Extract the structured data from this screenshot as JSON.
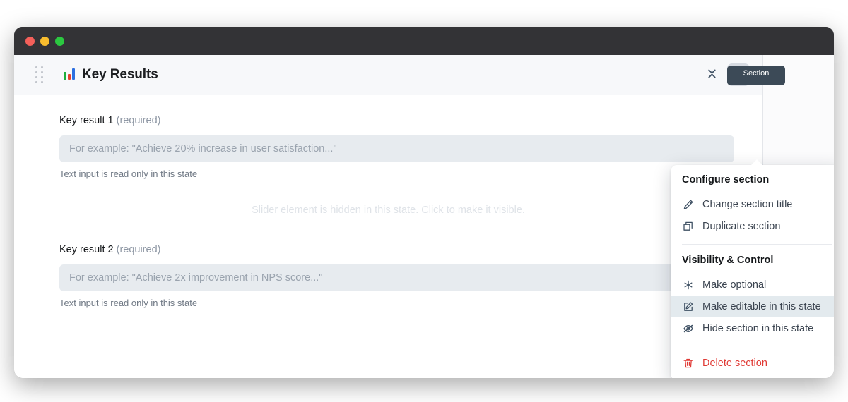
{
  "window": {
    "traffic_lights": [
      "close",
      "minimize",
      "maximize"
    ],
    "tooltip_text": "Section"
  },
  "section": {
    "emoji_icon": "bar-chart-emoji",
    "title": "Key Results",
    "drag_handle_icon": "drag-handle-icon",
    "collapse_icon": "collapse-chevrons-icon",
    "more_icon": "more-horizontal-icon"
  },
  "fields": [
    {
      "label": "Key result 1",
      "required_note": "(required)",
      "placeholder": "For example: \"Achieve 20% increase in user satisfaction...\"",
      "value": "",
      "help": "Text input is read only in this state"
    },
    {
      "label": "Key result 2",
      "required_note": "(required)",
      "placeholder": "For example: \"Achieve 2x improvement in NPS score...\"",
      "value": "",
      "help": "Text input is read only in this state"
    }
  ],
  "hidden_slider_note": "Slider element is hidden in this state. Click to make it visible.",
  "menu": {
    "groups": [
      {
        "title": "Configure section",
        "items": [
          {
            "label": "Change section title",
            "icon": "pencil-icon",
            "highlight": false,
            "danger": false
          },
          {
            "label": "Duplicate section",
            "icon": "duplicate-icon",
            "highlight": false,
            "danger": false
          }
        ]
      },
      {
        "title": "Visibility & Control",
        "items": [
          {
            "label": "Make optional",
            "icon": "asterisk-icon",
            "highlight": false,
            "danger": false
          },
          {
            "label": "Make editable in this state",
            "icon": "edit-square-icon",
            "highlight": true,
            "danger": false
          },
          {
            "label": "Hide section in this state",
            "icon": "eye-slash-icon",
            "highlight": false,
            "danger": false
          }
        ]
      }
    ],
    "danger_item": {
      "label": "Delete section",
      "icon": "trash-icon"
    }
  },
  "colors": {
    "titlebar": "#333336",
    "card_header": "#f7f8fa",
    "input_bg": "#e7ebef",
    "menu_highlight": "#e3eaee",
    "danger": "#e03a35",
    "tooltip_bg": "#3c4a57"
  }
}
